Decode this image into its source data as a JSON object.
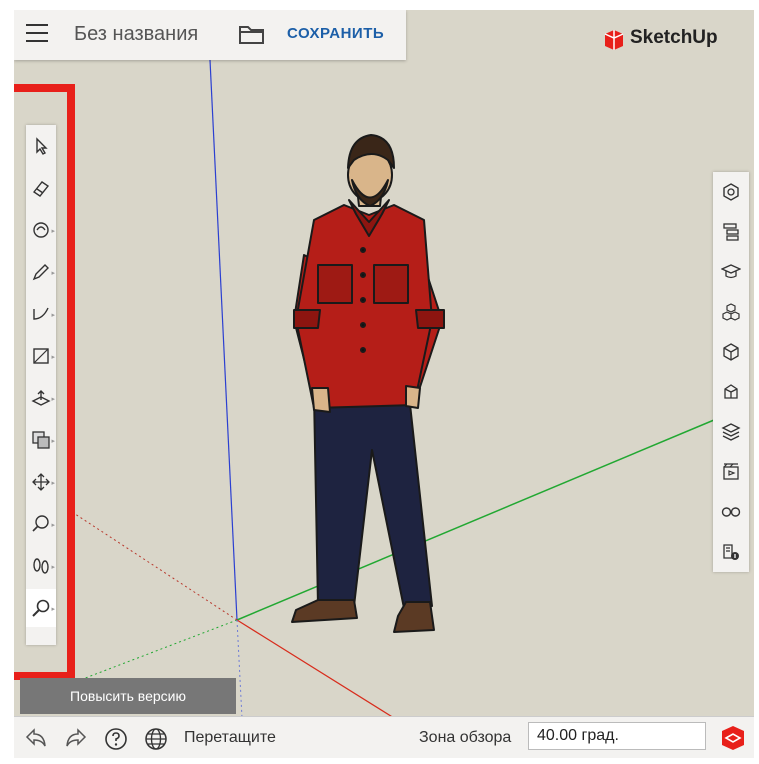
{
  "header": {
    "title": "Без названия",
    "save_label": "СОХРАНИТЬ",
    "logo_text": "SketchUp"
  },
  "left_toolbar": {
    "tools": [
      {
        "icon": "select-arrow-icon"
      },
      {
        "icon": "eraser-icon"
      },
      {
        "icon": "paint-bucket-icon"
      },
      {
        "icon": "pencil-icon"
      },
      {
        "icon": "arc-icon"
      },
      {
        "icon": "rectangle-icon"
      },
      {
        "icon": "push-pull-icon"
      },
      {
        "icon": "offset-icon"
      },
      {
        "icon": "move-icon"
      },
      {
        "icon": "tape-measure-icon"
      },
      {
        "icon": "walk-icon"
      },
      {
        "icon": "zoom-icon"
      }
    ],
    "active_tool": "zoom-icon"
  },
  "right_toolbar": {
    "panels": [
      {
        "icon": "entity-info-icon"
      },
      {
        "icon": "outliner-icon"
      },
      {
        "icon": "instructor-icon"
      },
      {
        "icon": "components-icon"
      },
      {
        "icon": "materials-icon"
      },
      {
        "icon": "styles-icon"
      },
      {
        "icon": "layers-icon"
      },
      {
        "icon": "scenes-icon"
      },
      {
        "icon": "display-icon"
      },
      {
        "icon": "model-info-icon"
      }
    ]
  },
  "upgrade_label": "Повысить версию",
  "status_bar": {
    "hint": "Перетащите",
    "fov_label": "Зона обзора",
    "fov_value": "40.00 град."
  },
  "colors": {
    "canvas": "#d9d6c9",
    "axis_blue": "#2b3fd1",
    "axis_green": "#22a832",
    "axis_red": "#d82c1c",
    "highlight": "#e8201a",
    "save_blue": "#1c5fa8"
  }
}
